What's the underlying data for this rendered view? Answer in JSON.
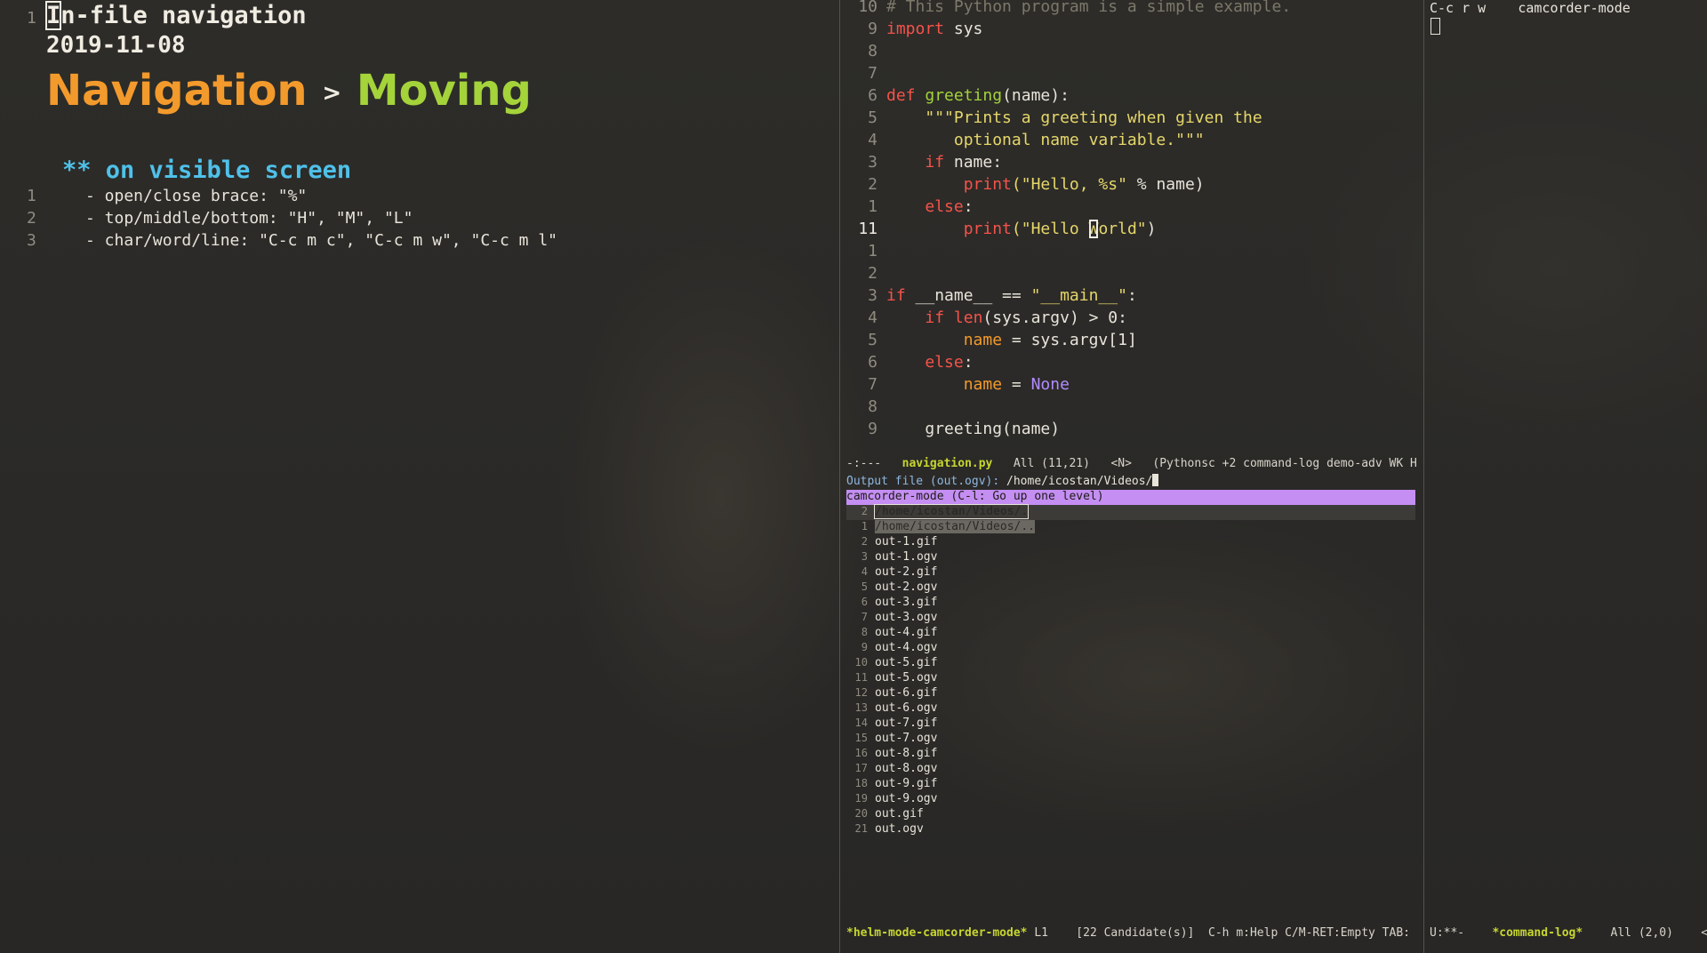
{
  "left": {
    "title_line_number": "1",
    "title": "In-file navigation",
    "date": "2019-11-08",
    "breadcrumb_primary": "Navigation",
    "breadcrumb_separator": ">",
    "breadcrumb_secondary": "Moving",
    "section_heading": "** on visible screen",
    "items": [
      {
        "num": "1",
        "text": "- open/close brace: \"%\""
      },
      {
        "num": "2",
        "text": "- top/middle/bottom: \"H\", \"M\", \"L\""
      },
      {
        "num": "3",
        "text": "- char/word/line: \"C-c m c\", \"C-c m w\", \"C-c m l\""
      }
    ]
  },
  "code": {
    "line_numbers": [
      "10",
      "9",
      "8",
      "7",
      "6",
      "5",
      "4",
      "3",
      "2",
      "1",
      "11",
      "1",
      "2",
      "3",
      "4",
      "5",
      "6",
      "7",
      "8",
      "9"
    ],
    "line_1": "# This Python program is a simple example.",
    "import_kw": "import",
    "import_mod": " sys",
    "def_kw": "def",
    "def_name": "greeting",
    "def_args": "(name):",
    "doc_1": "\"\"\"Prints a greeting when given the",
    "doc_2": "optional name variable.\"\"\"",
    "if_kw": "if",
    "if_cond": " name:",
    "print_fn": "print",
    "print_arg_1": "(\"Hello, %s\"",
    "print_rest_1": " % name)",
    "else_kw": "else",
    "colon": ":",
    "print_arg_2a": "(\"Hello ",
    "print_arg_2_cursor": "W",
    "print_arg_2b": "orld\"",
    "print_rest_2": ")",
    "main_if": "if",
    "main_cond_a": " __name__ == ",
    "main_str": "\"__main__\"",
    "main_cond_b": ":",
    "len_fn": "len",
    "len_rest": "(sys.argv) > 0:",
    "name_var": "name",
    "assign_1": " = sys.argv[1]",
    "assign_2": " = ",
    "none_const": "None",
    "call": "greeting(name)"
  },
  "modeline_code": {
    "status": "-:---",
    "buffer": "navigation.py",
    "position": "All (11,21)",
    "state": "<N>",
    "modes": "(Pythonsc +2 command-log demo-adv WK H"
  },
  "minibuffer": {
    "prompt_label": "Output file (out.ogv):",
    "prompt_value": " /home/icostan/Videos/"
  },
  "helm": {
    "header": "camcorder-mode (C-l: Go up one level)",
    "items": [
      {
        "num": "2",
        "text": "/home/icostan/Videos/."
      },
      {
        "num": "1",
        "text": "/home/icostan/Videos/.."
      },
      {
        "num": "2",
        "text": "out-1.gif"
      },
      {
        "num": "3",
        "text": "out-1.ogv"
      },
      {
        "num": "4",
        "text": "out-2.gif"
      },
      {
        "num": "5",
        "text": "out-2.ogv"
      },
      {
        "num": "6",
        "text": "out-3.gif"
      },
      {
        "num": "7",
        "text": "out-3.ogv"
      },
      {
        "num": "8",
        "text": "out-4.gif"
      },
      {
        "num": "9",
        "text": "out-4.ogv"
      },
      {
        "num": "10",
        "text": "out-5.gif"
      },
      {
        "num": "11",
        "text": "out-5.ogv"
      },
      {
        "num": "12",
        "text": "out-6.gif"
      },
      {
        "num": "13",
        "text": "out-6.ogv"
      },
      {
        "num": "14",
        "text": "out-7.gif"
      },
      {
        "num": "15",
        "text": "out-7.ogv"
      },
      {
        "num": "16",
        "text": "out-8.gif"
      },
      {
        "num": "17",
        "text": "out-8.ogv"
      },
      {
        "num": "18",
        "text": "out-9.gif"
      },
      {
        "num": "19",
        "text": "out-9.ogv"
      },
      {
        "num": "20",
        "text": "out.gif"
      },
      {
        "num": "21",
        "text": "out.ogv"
      }
    ]
  },
  "modeline_helm": {
    "buffer": "*helm-mode-camcorder-mode*",
    "line": "L1",
    "candidates": "[22 Candidate(s)]",
    "help": "C-h m:Help C/M-RET:Empty TAB:"
  },
  "right": {
    "keys": "C-c r w",
    "command": "camcorder-mode"
  },
  "modeline_right": {
    "status": "U:**-",
    "buffer": "*command-log*",
    "position": "All (2,0)",
    "tail": "<"
  }
}
